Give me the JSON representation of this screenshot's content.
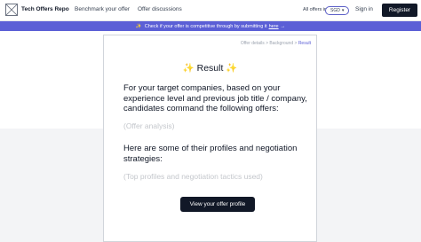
{
  "navbar": {
    "brand": "Tech Offers Repo",
    "links": [
      "Benchmark your offer",
      "Offer discussions"
    ],
    "offers_count": "All offers in",
    "currency": "SGD",
    "currency_caret": "▾",
    "signin": "Sign in",
    "register": "Register"
  },
  "banner": {
    "sparkle": "✨",
    "text": "Check if your offer is competitive through by submitting it",
    "link": "here",
    "arrow": "→"
  },
  "card": {
    "breadcrumb": [
      "Offer details",
      "Background",
      "Result"
    ],
    "breadcrumb_sep": ">",
    "title": "Result",
    "sparkle": "✨",
    "intro": "For your target companies, based on your experience level and previous job title / company, candidates command the following offers:",
    "offer_analysis_placeholder": "(Offer analysis)",
    "profiles_intro": "Here are some of their profiles and negotiation strategies:",
    "profiles_placeholder": "(Top profiles and negotiation tactics used)",
    "cta": "View your offer profile"
  },
  "colors": {
    "accent": "#5b5fd6",
    "dark": "#111827",
    "placeholder": "#c4c7cc"
  }
}
